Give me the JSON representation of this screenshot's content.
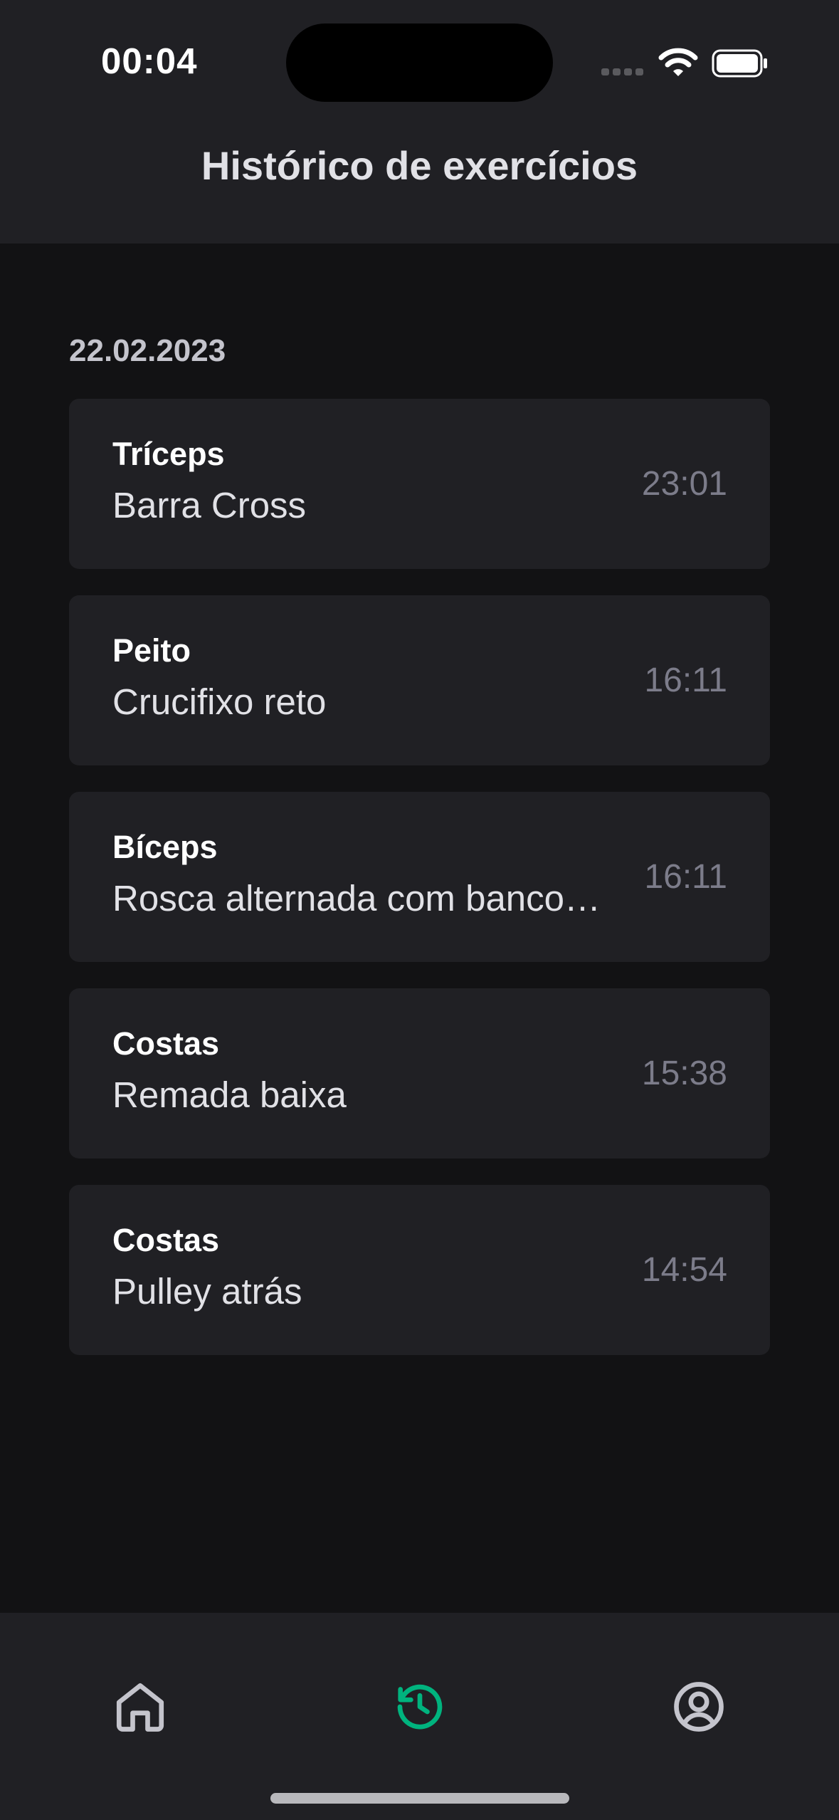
{
  "status_bar": {
    "time": "00:04"
  },
  "header": {
    "title": "Histórico de exercícios"
  },
  "history": {
    "date": "22.02.2023",
    "items": [
      {
        "group": "Tríceps",
        "name": "Barra Cross",
        "time": "23:01"
      },
      {
        "group": "Peito",
        "name": "Crucifixo reto",
        "time": "16:11"
      },
      {
        "group": "Bíceps",
        "name": "Rosca alternada com banco inclinado",
        "time": "16:11"
      },
      {
        "group": "Costas",
        "name": "Remada baixa",
        "time": "15:38"
      },
      {
        "group": "Costas",
        "name": "Pulley atrás",
        "time": "14:54"
      }
    ]
  },
  "tabbar": {
    "tabs": [
      {
        "icon": "home-icon",
        "active": false
      },
      {
        "icon": "history-icon",
        "active": true
      },
      {
        "icon": "user-circle-icon",
        "active": false
      }
    ]
  },
  "colors": {
    "background": "#121214",
    "surface": "#202024",
    "accent": "#00B37E",
    "inactive_icon": "#C4C4CC",
    "time_text": "#7C7C8A"
  }
}
